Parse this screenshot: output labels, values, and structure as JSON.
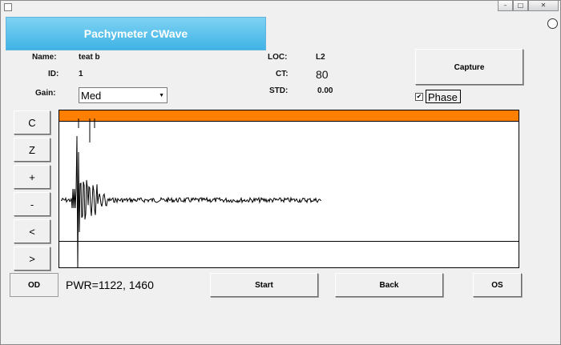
{
  "window": {
    "minimize_glyph": "–",
    "maximize_glyph": "□",
    "close_glyph": "✕"
  },
  "header": {
    "title": "Pachymeter CWave",
    "banner_color": "#4bbbea"
  },
  "fields": {
    "name_label": "Name:",
    "name_value": "teat b",
    "id_label": "ID:",
    "id_value": "1",
    "gain_label": "Gain:",
    "gain_value": "Med",
    "loc_label": "LOC:",
    "loc_value": "L2",
    "ct_label": "CT:",
    "ct_value": "80",
    "std_label": "STD:",
    "std_value": "0.00"
  },
  "buttons": {
    "capture": "Capture",
    "start": "Start",
    "back": "Back",
    "os": "OS",
    "od": "OD"
  },
  "side_buttons": [
    "C",
    "Z",
    "+",
    "-",
    "<",
    ">"
  ],
  "phase": {
    "label": "Phase",
    "checked": true,
    "check_glyph": "✔"
  },
  "status": {
    "pwr": "PWR=1122, 1460"
  },
  "plot": {
    "header_color": "#ff8000",
    "trace_color": "#000000"
  }
}
